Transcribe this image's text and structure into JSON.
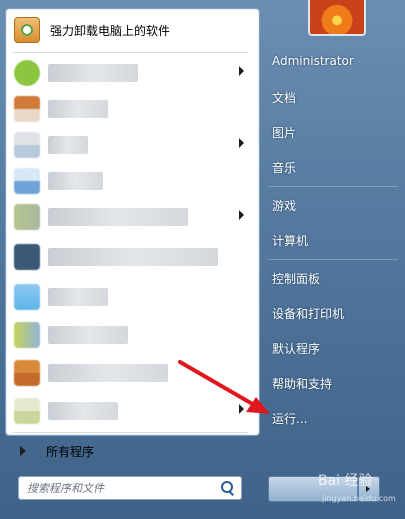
{
  "start_menu": {
    "pinned": {
      "label": "强力卸载电脑上的软件",
      "icon": "uninstaller-app-icon"
    },
    "recent_programs": [
      {
        "label": "",
        "has_submenu": true,
        "icon_color": "#8cc63f"
      },
      {
        "label": "",
        "has_submenu": false,
        "icon_color": "#d27a3a"
      },
      {
        "label": "",
        "has_submenu": true,
        "icon_color": "#9db8d8"
      },
      {
        "label": "",
        "has_submenu": false,
        "icon_color": "#6fa3d8"
      },
      {
        "label": "",
        "has_submenu": true,
        "icon_color": "#b5c48c"
      },
      {
        "label": "",
        "has_submenu": false,
        "icon_color": "#3b5876"
      },
      {
        "label": "",
        "has_submenu": false,
        "icon_color": "#5eb5ea"
      },
      {
        "label": "",
        "has_submenu": false,
        "icon_color": "#c7d25a"
      },
      {
        "label": "",
        "has_submenu": false,
        "icon_color": "#d88a3b"
      },
      {
        "label": "",
        "has_submenu": true,
        "icon_color": "#c9d79a"
      }
    ],
    "all_programs_label": "所有程序",
    "search_placeholder": "搜索程序和文件",
    "right_items": {
      "user": "Administrator",
      "documents": "文档",
      "pictures": "图片",
      "music": "音乐",
      "games": "游戏",
      "computer": "计算机",
      "control_panel": "控制面板",
      "devices_printers": "设备和打印机",
      "default_programs": "默认程序",
      "help": "帮助和支持",
      "run": "运行..."
    },
    "watermark": "Bai 经验",
    "watermark_sub": "jingyan.baidu.com",
    "colors": {
      "accent_arrow": "#e0171c",
      "panel_bg": "#4f7399"
    }
  }
}
